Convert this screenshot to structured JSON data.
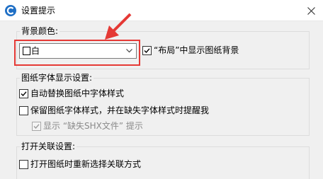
{
  "window": {
    "title": "设置提示",
    "close_glyph": "✕",
    "icon": "app-logo-icon"
  },
  "background_group": {
    "label": "背景颜色:",
    "color_select": {
      "value": "白",
      "swatch_color": "#ffffff",
      "arrow_icon": "chevron-down-icon"
    },
    "layout_bg_checkbox": {
      "label": "“布局”中显示图纸背景",
      "checked": true
    }
  },
  "font_group": {
    "label": "图纸字体显示设置:",
    "auto_replace": {
      "label": "自动替换图纸中字体样式",
      "checked": true
    },
    "keep_style": {
      "label": "保留图纸字体样式，并在缺失字体样式时提醒我",
      "checked": false
    },
    "show_shx_missing": {
      "label": "显示 “缺失SHX文件” 提示",
      "checked": true,
      "disabled": true
    }
  },
  "link_group": {
    "label": "打开关联设置:",
    "reselect_link": {
      "label": "打开图纸时重新选择关联方式",
      "checked": false
    }
  },
  "annotation": {
    "highlight_color": "#e53935"
  }
}
